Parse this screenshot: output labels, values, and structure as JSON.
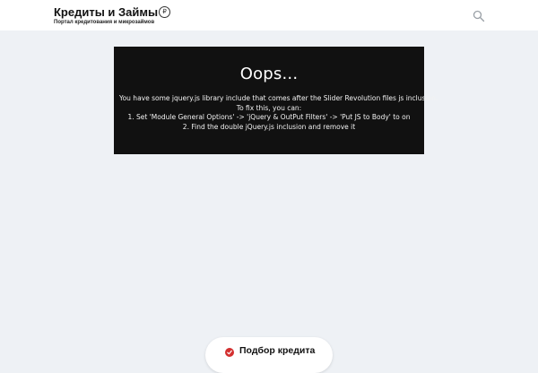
{
  "header": {
    "logo_title": "Кредиты и Займы",
    "logo_badge": "₽",
    "logo_subtitle": "Портал кредитования и микрозаймов",
    "search_icon": "search-icon"
  },
  "error": {
    "title": "Oops...",
    "lines": [
      "You have some jquery.js library include that comes after the Slider Revolution files js inclusion.",
      "To fix this, you can:",
      "1. Set 'Module General Options' -> 'jQuery & OutPut Filters' -> 'Put JS to Body' to on",
      "2. Find the double jQuery.js inclusion and remove it"
    ]
  },
  "bubble": {
    "label": "Подбор кредита",
    "icon": "check-circle-icon"
  },
  "colors": {
    "background": "#eef1f5",
    "header": "#ffffff",
    "error_box": "#111111",
    "accent": "#d32f2f"
  }
}
